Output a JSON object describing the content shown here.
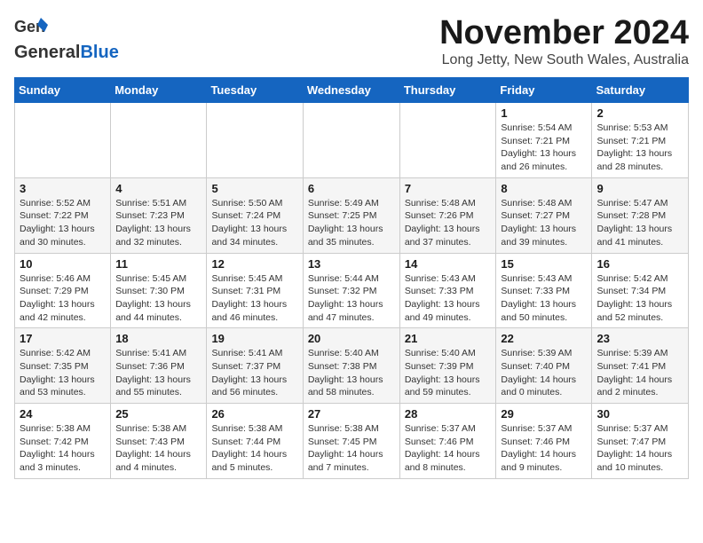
{
  "logo": {
    "line1": "General",
    "line2": "Blue"
  },
  "title": "November 2024",
  "location": "Long Jetty, New South Wales, Australia",
  "weekdays": [
    "Sunday",
    "Monday",
    "Tuesday",
    "Wednesday",
    "Thursday",
    "Friday",
    "Saturday"
  ],
  "weeks": [
    [
      {
        "day": "",
        "info": ""
      },
      {
        "day": "",
        "info": ""
      },
      {
        "day": "",
        "info": ""
      },
      {
        "day": "",
        "info": ""
      },
      {
        "day": "",
        "info": ""
      },
      {
        "day": "1",
        "info": "Sunrise: 5:54 AM\nSunset: 7:21 PM\nDaylight: 13 hours\nand 26 minutes."
      },
      {
        "day": "2",
        "info": "Sunrise: 5:53 AM\nSunset: 7:21 PM\nDaylight: 13 hours\nand 28 minutes."
      }
    ],
    [
      {
        "day": "3",
        "info": "Sunrise: 5:52 AM\nSunset: 7:22 PM\nDaylight: 13 hours\nand 30 minutes."
      },
      {
        "day": "4",
        "info": "Sunrise: 5:51 AM\nSunset: 7:23 PM\nDaylight: 13 hours\nand 32 minutes."
      },
      {
        "day": "5",
        "info": "Sunrise: 5:50 AM\nSunset: 7:24 PM\nDaylight: 13 hours\nand 34 minutes."
      },
      {
        "day": "6",
        "info": "Sunrise: 5:49 AM\nSunset: 7:25 PM\nDaylight: 13 hours\nand 35 minutes."
      },
      {
        "day": "7",
        "info": "Sunrise: 5:48 AM\nSunset: 7:26 PM\nDaylight: 13 hours\nand 37 minutes."
      },
      {
        "day": "8",
        "info": "Sunrise: 5:48 AM\nSunset: 7:27 PM\nDaylight: 13 hours\nand 39 minutes."
      },
      {
        "day": "9",
        "info": "Sunrise: 5:47 AM\nSunset: 7:28 PM\nDaylight: 13 hours\nand 41 minutes."
      }
    ],
    [
      {
        "day": "10",
        "info": "Sunrise: 5:46 AM\nSunset: 7:29 PM\nDaylight: 13 hours\nand 42 minutes."
      },
      {
        "day": "11",
        "info": "Sunrise: 5:45 AM\nSunset: 7:30 PM\nDaylight: 13 hours\nand 44 minutes."
      },
      {
        "day": "12",
        "info": "Sunrise: 5:45 AM\nSunset: 7:31 PM\nDaylight: 13 hours\nand 46 minutes."
      },
      {
        "day": "13",
        "info": "Sunrise: 5:44 AM\nSunset: 7:32 PM\nDaylight: 13 hours\nand 47 minutes."
      },
      {
        "day": "14",
        "info": "Sunrise: 5:43 AM\nSunset: 7:33 PM\nDaylight: 13 hours\nand 49 minutes."
      },
      {
        "day": "15",
        "info": "Sunrise: 5:43 AM\nSunset: 7:33 PM\nDaylight: 13 hours\nand 50 minutes."
      },
      {
        "day": "16",
        "info": "Sunrise: 5:42 AM\nSunset: 7:34 PM\nDaylight: 13 hours\nand 52 minutes."
      }
    ],
    [
      {
        "day": "17",
        "info": "Sunrise: 5:42 AM\nSunset: 7:35 PM\nDaylight: 13 hours\nand 53 minutes."
      },
      {
        "day": "18",
        "info": "Sunrise: 5:41 AM\nSunset: 7:36 PM\nDaylight: 13 hours\nand 55 minutes."
      },
      {
        "day": "19",
        "info": "Sunrise: 5:41 AM\nSunset: 7:37 PM\nDaylight: 13 hours\nand 56 minutes."
      },
      {
        "day": "20",
        "info": "Sunrise: 5:40 AM\nSunset: 7:38 PM\nDaylight: 13 hours\nand 58 minutes."
      },
      {
        "day": "21",
        "info": "Sunrise: 5:40 AM\nSunset: 7:39 PM\nDaylight: 13 hours\nand 59 minutes."
      },
      {
        "day": "22",
        "info": "Sunrise: 5:39 AM\nSunset: 7:40 PM\nDaylight: 14 hours\nand 0 minutes."
      },
      {
        "day": "23",
        "info": "Sunrise: 5:39 AM\nSunset: 7:41 PM\nDaylight: 14 hours\nand 2 minutes."
      }
    ],
    [
      {
        "day": "24",
        "info": "Sunrise: 5:38 AM\nSunset: 7:42 PM\nDaylight: 14 hours\nand 3 minutes."
      },
      {
        "day": "25",
        "info": "Sunrise: 5:38 AM\nSunset: 7:43 PM\nDaylight: 14 hours\nand 4 minutes."
      },
      {
        "day": "26",
        "info": "Sunrise: 5:38 AM\nSunset: 7:44 PM\nDaylight: 14 hours\nand 5 minutes."
      },
      {
        "day": "27",
        "info": "Sunrise: 5:38 AM\nSunset: 7:45 PM\nDaylight: 14 hours\nand 7 minutes."
      },
      {
        "day": "28",
        "info": "Sunrise: 5:37 AM\nSunset: 7:46 PM\nDaylight: 14 hours\nand 8 minutes."
      },
      {
        "day": "29",
        "info": "Sunrise: 5:37 AM\nSunset: 7:46 PM\nDaylight: 14 hours\nand 9 minutes."
      },
      {
        "day": "30",
        "info": "Sunrise: 5:37 AM\nSunset: 7:47 PM\nDaylight: 14 hours\nand 10 minutes."
      }
    ]
  ]
}
